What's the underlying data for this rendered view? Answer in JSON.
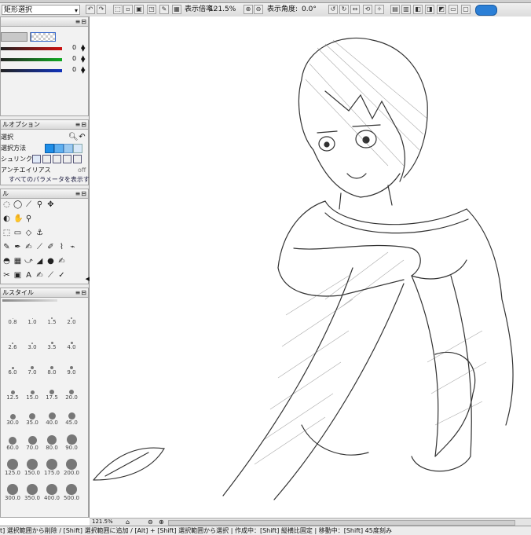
{
  "toolbar": {
    "tool_select": "矩形選択",
    "zoom_label": "表示倍率:",
    "zoom_value": "121.5%",
    "angle_label": "表示角度:",
    "angle_value": "0.0°"
  },
  "color_panel": {
    "sliders": [
      {
        "color": "#cc1111",
        "value": "0"
      },
      {
        "color": "#11aa22",
        "value": "0"
      },
      {
        "color": "#1133bb",
        "value": "0"
      }
    ]
  },
  "tool_options": {
    "title": "ルオプション",
    "select_label": "選択",
    "method_label": "選択方法",
    "link_label": "シュリンク",
    "antialias_label": "アンチエイリアス",
    "antialias_value": "off",
    "show_all_params": "すべてのパラメータを表示する"
  },
  "tools_panel": {
    "title": "ル"
  },
  "brush_panel": {
    "title": "ルスタイル",
    "sizes": [
      "0.8",
      "1.0",
      "1.5",
      "2.0",
      "2.6",
      "3.0",
      "3.5",
      "4.0",
      "6.0",
      "7.0",
      "8.0",
      "9.0",
      "12.5",
      "15.0",
      "17.5",
      "20.0",
      "30.0",
      "35.0",
      "40.0",
      "45.0",
      "60.0",
      "70.0",
      "80.0",
      "90.0",
      "125.0",
      "150.0",
      "175.0",
      "200.0",
      "300.0",
      "350.0",
      "400.0",
      "500.0"
    ]
  },
  "bottom_bar": {
    "zoom": "121.5%"
  },
  "status": {
    "text": "t] 選択範囲から削除 / [Shift] 選択範囲に追加 / [Alt] + [Shift] 選択範囲から選択 | 作成中：[Shift] 縦横比固定 | 移動中：[Shift] 45度刻み"
  }
}
